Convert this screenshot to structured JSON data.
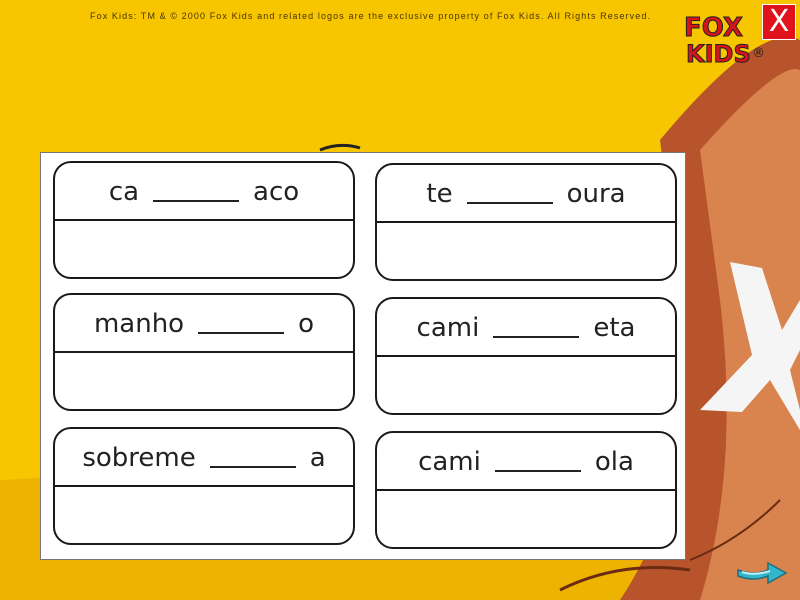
{
  "header": {
    "copyright": "Fox Kids: TM & © 2000 Fox Kids and related logos are the exclusive property of Fox Kids. All Rights Reserved.",
    "logo_text": [
      "FOX",
      "KIDS"
    ],
    "registered_mark": "®",
    "close_label": "X"
  },
  "worksheet": {
    "cards": [
      {
        "before": "ca",
        "after": "aco"
      },
      {
        "before": "te",
        "after": "oura"
      },
      {
        "before": "manho",
        "after": "o"
      },
      {
        "before": "cami",
        "after": "eta"
      },
      {
        "before": "sobreme",
        "after": "a"
      },
      {
        "before": "cami",
        "after": "ola"
      }
    ]
  },
  "navigation": {
    "next_icon": "arrow-right-icon"
  },
  "colors": {
    "background": "#f7c600",
    "close": "#e0121b",
    "arrow": "#33b6c9"
  }
}
